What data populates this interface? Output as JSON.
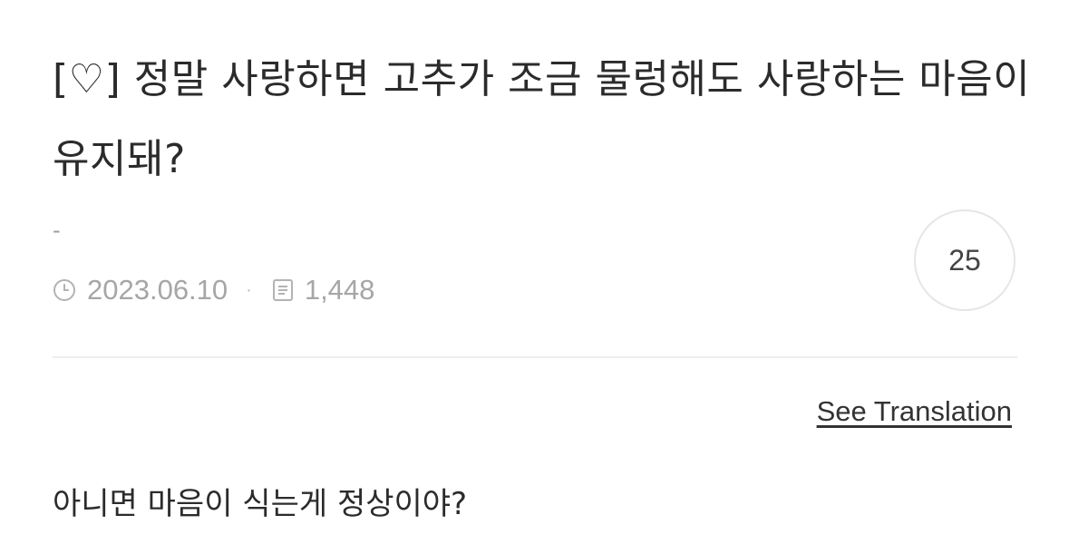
{
  "post": {
    "title": "[♡] 정말 사랑하면 고추가 조금 물렁해도 사랑하는 마음이 유지돼?",
    "author": "-",
    "date": "2023.06.10",
    "separator": "·",
    "views": "1,448",
    "comment_count": "25",
    "see_translation": "See Translation",
    "body": "아니면 마음이 식는게 정상이야?"
  },
  "icons": {
    "date": "clock-icon",
    "views": "document-icon"
  },
  "colors": {
    "text": "#2b2b2b",
    "meta": "#a6a6a6",
    "divider": "#ececec",
    "badge_border": "#e6e6e6"
  }
}
